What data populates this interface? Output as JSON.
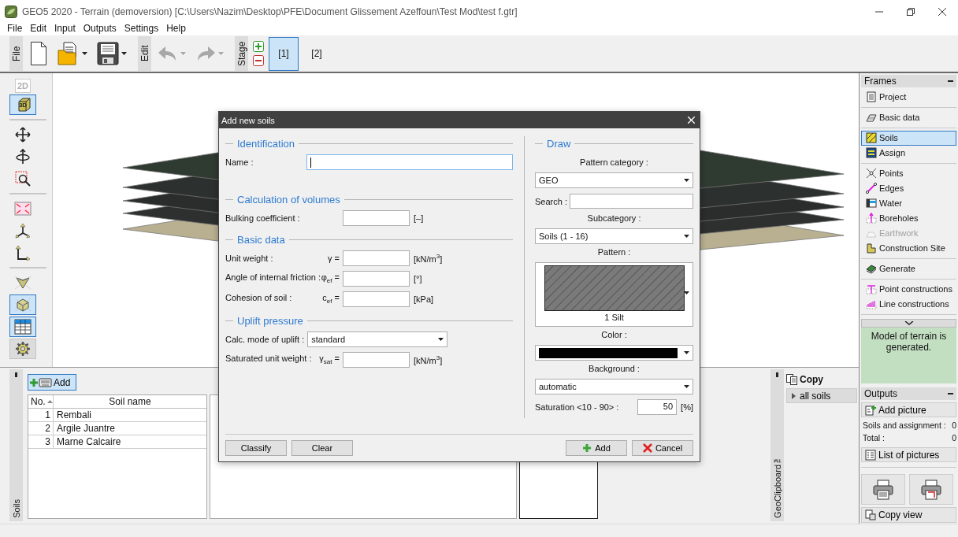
{
  "window": {
    "title": "GEO5 2020 - Terrain (demoversion) [C:\\Users\\Nazim\\Desktop\\PFE\\Document Glissement Azeffoun\\Test Mod\\test f.gtr]"
  },
  "menu": [
    "File",
    "Edit",
    "Input",
    "Outputs",
    "Settings",
    "Help"
  ],
  "toolbar": {
    "groups": [
      {
        "label": "File",
        "tools": [
          {
            "kind": "new",
            "dropdown": false,
            "disabled": false
          },
          {
            "kind": "open",
            "dropdown": true,
            "disabled": false
          },
          {
            "kind": "save",
            "dropdown": true,
            "disabled": false
          }
        ]
      },
      {
        "label": "Edit",
        "tools": [
          {
            "kind": "undo",
            "dropdown": true,
            "disabled": true
          },
          {
            "kind": "redo",
            "dropdown": true,
            "disabled": true
          }
        ]
      },
      {
        "label": "Stage",
        "tools": [
          {
            "kind": "stage-buttons"
          }
        ]
      }
    ],
    "stages": [
      {
        "label": "[1]",
        "selected": true
      },
      {
        "label": "[2]",
        "selected": false
      }
    ]
  },
  "view_tools": [
    [
      {
        "kind": "plan",
        "label": "2D",
        "selected": false,
        "disabled": true
      },
      {
        "kind": "solid",
        "label": "3D",
        "selected": true,
        "disabled": false
      }
    ],
    [
      {
        "kind": "move",
        "selected": false,
        "disabled": false
      },
      {
        "kind": "rotate",
        "selected": false,
        "disabled": false
      },
      {
        "kind": "zoom",
        "selected": false,
        "disabled": false
      }
    ],
    [
      {
        "kind": "fit",
        "selected": false,
        "disabled": false
      },
      {
        "kind": "axes3",
        "selected": false,
        "disabled": false
      },
      {
        "kind": "axes2",
        "selected": false,
        "disabled": false
      }
    ],
    [
      {
        "kind": "view-front",
        "selected": false,
        "disabled": false
      },
      {
        "kind": "view-iso",
        "selected": true,
        "disabled": false
      },
      {
        "kind": "table",
        "selected": true,
        "disabled": false
      },
      {
        "kind": "settings",
        "selected": false,
        "disabled": false
      }
    ]
  ],
  "soils_panel": {
    "tab_label": "Soils",
    "add_button": "Add",
    "table": {
      "columns": [
        "No.",
        "Soil name"
      ],
      "rows": [
        [
          "1",
          "Rembali"
        ],
        [
          "2",
          "Argile Juantre"
        ],
        [
          "3",
          "Marne Calcaire"
        ]
      ]
    }
  },
  "clipboard": {
    "tab_label": "GeoClipboard™",
    "copy_label": "Copy",
    "all_soils": "all soils"
  },
  "frames": {
    "title": "Frames",
    "groups": [
      [
        {
          "kind": "project",
          "label": "Project",
          "selected": false,
          "disabled": false
        }
      ],
      [
        {
          "kind": "basic",
          "label": "Basic data",
          "selected": false,
          "disabled": false
        }
      ],
      [
        {
          "kind": "soils",
          "label": "Soils",
          "selected": true,
          "disabled": false
        },
        {
          "kind": "assign",
          "label": "Assign",
          "selected": false,
          "disabled": false
        }
      ],
      [
        {
          "kind": "points",
          "label": "Points",
          "selected": false,
          "disabled": false
        },
        {
          "kind": "edges",
          "label": "Edges",
          "selected": false,
          "disabled": false
        },
        {
          "kind": "water",
          "label": "Water",
          "selected": false,
          "disabled": false
        },
        {
          "kind": "boreholes",
          "label": "Boreholes",
          "selected": false,
          "disabled": false
        },
        {
          "kind": "earthwork",
          "label": "Earthwork",
          "selected": false,
          "disabled": true
        },
        {
          "kind": "site",
          "label": "Construction Site",
          "selected": false,
          "disabled": false
        }
      ],
      [
        {
          "kind": "generate",
          "label": "Generate",
          "selected": false,
          "disabled": false
        }
      ],
      [
        {
          "kind": "point-constr",
          "label": "Point constructions",
          "selected": false,
          "disabled": false
        },
        {
          "kind": "line-constr",
          "label": "Line constructions",
          "selected": false,
          "disabled": false
        }
      ]
    ],
    "note": "Model of terrain is generated."
  },
  "outputs": {
    "title": "Outputs",
    "add_picture": "Add picture",
    "counts": [
      {
        "label": "Soils and assignment :",
        "value": "0"
      },
      {
        "label": "Total :",
        "value": "0"
      }
    ],
    "list_pictures": "List of pictures",
    "copy_view": "Copy view"
  },
  "dialog": {
    "title": "Add new soils",
    "sections": [
      {
        "heading": "Identification",
        "rows": [
          {
            "kind": "name",
            "label": "Name :",
            "focused": true
          }
        ]
      },
      {
        "heading": "Calculation of volumes",
        "rows": [
          {
            "kind": "input",
            "label": "Bulking coefficient :",
            "unit": "[–]"
          }
        ]
      },
      {
        "heading": "Basic data",
        "rows": [
          {
            "kind": "input",
            "label": "Unit weight :",
            "symbol": "γ =",
            "unit": "[kN/m$^{3}$]"
          },
          {
            "kind": "input",
            "label": "Angle of internal friction :",
            "symbol": "φ$_{ef}$ =",
            "unit": "[°]"
          },
          {
            "kind": "input",
            "label": "Cohesion of soil :",
            "symbol": "c$_{ef}$ =",
            "unit": "[kPa]"
          }
        ]
      },
      {
        "heading": "Uplift pressure",
        "rows": [
          {
            "kind": "select",
            "label": "Calc. mode of uplift :",
            "value": "standard"
          },
          {
            "kind": "input",
            "label": "Saturated unit weight :",
            "symbol": "γ$_{sat}$ =",
            "unit": "[kN/m$^{3}$]"
          }
        ]
      }
    ],
    "draw": {
      "heading": "Draw",
      "pattern_category_label": "Pattern category :",
      "pattern_category": "GEO",
      "search_label": "Search :",
      "subcategory_label": "Subcategory :",
      "subcategory": "Soils (1 - 16)",
      "pattern_label": "Pattern :",
      "pattern_name": "1 Silt",
      "color_label": "Color :",
      "color": "#000000",
      "background_label": "Background :",
      "background": "automatic",
      "saturation_label": "Saturation <10 - 90> :",
      "saturation": "50",
      "saturation_unit": "[%]"
    },
    "buttons": [
      {
        "kind": "plain",
        "label": "Classify"
      },
      {
        "kind": "plain",
        "label": "Clear"
      },
      {
        "kind": "add",
        "label": "Add"
      },
      {
        "kind": "cancel",
        "label": "Cancel"
      }
    ]
  }
}
